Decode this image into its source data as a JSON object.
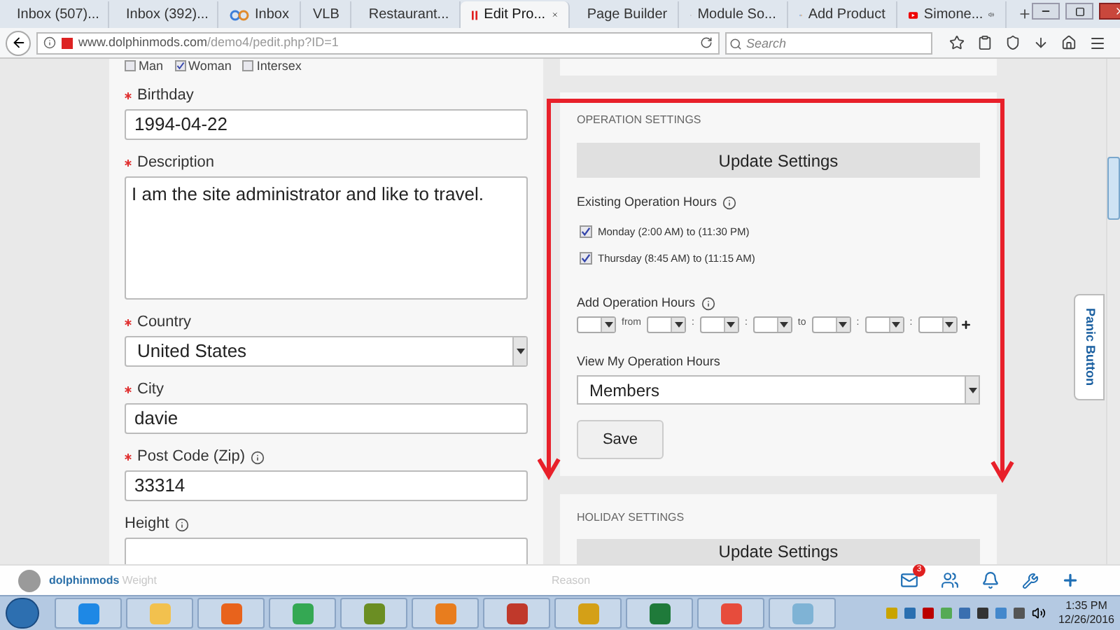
{
  "browser": {
    "tabs": [
      {
        "label": "Inbox (507)...",
        "kind": "mail",
        "selected": false
      },
      {
        "label": "Inbox (392)...",
        "kind": "mail",
        "selected": false
      },
      {
        "label": "Inbox",
        "kind": "loop",
        "selected": false
      },
      {
        "label": "VLB",
        "kind": "plain",
        "selected": false
      },
      {
        "label": "Restaurant...",
        "kind": "loop",
        "selected": false
      },
      {
        "label": "Edit Pro...",
        "kind": "bars",
        "selected": true
      },
      {
        "label": "Page Builder",
        "kind": "bars",
        "selected": false
      },
      {
        "label": "Module So...",
        "kind": "loop",
        "selected": false
      },
      {
        "label": "Add Product",
        "kind": "loop",
        "selected": false
      },
      {
        "label": "Simone...",
        "kind": "video",
        "selected": false,
        "audio": true
      }
    ],
    "url": {
      "domain": "www.dolphinmods.com",
      "path": "/demo4/pedit.php?ID=1"
    },
    "search": {
      "placeholder": "Search"
    }
  },
  "profile_form": {
    "gender_options": [
      {
        "label": "Man",
        "checked": false
      },
      {
        "label": "Woman",
        "checked": true
      },
      {
        "label": "Intersex",
        "checked": false
      }
    ],
    "fields": [
      {
        "kind": "input",
        "label": "Birthday",
        "required": true,
        "info": false,
        "value": "1994-04-22"
      },
      {
        "kind": "textarea",
        "label": "Description",
        "required": true,
        "info": false,
        "value": "I am the site administrator and like to travel."
      },
      {
        "kind": "select",
        "label": "Country",
        "required": true,
        "info": false,
        "value": "United States"
      },
      {
        "kind": "input",
        "label": "City",
        "required": true,
        "info": false,
        "value": "davie"
      },
      {
        "kind": "input",
        "label": "Post Code (Zip)",
        "required": true,
        "info": true,
        "value": "33314"
      },
      {
        "kind": "input",
        "label": "Height",
        "required": false,
        "info": true
      }
    ]
  },
  "operation_settings": {
    "heading": "OPERATION SETTINGS",
    "update_button": "Update Settings",
    "existing_label": "Existing Operation Hours",
    "hours": [
      {
        "label": "Monday (2:00 AM) to (11:30 PM)",
        "checked": true
      },
      {
        "label": "Thursday (8:45 AM) to (11:15 AM)",
        "checked": true
      }
    ],
    "add_label": "Add Operation Hours",
    "add_row": [
      {
        "kind": "select"
      },
      {
        "kind": "text",
        "text": "from"
      },
      {
        "kind": "select"
      },
      {
        "kind": "text",
        "text": ":"
      },
      {
        "kind": "select"
      },
      {
        "kind": "text",
        "text": ":"
      },
      {
        "kind": "select"
      },
      {
        "kind": "text",
        "text": "to"
      },
      {
        "kind": "select"
      },
      {
        "kind": "text",
        "text": ":"
      },
      {
        "kind": "select"
      },
      {
        "kind": "text",
        "text": ":"
      },
      {
        "kind": "select"
      }
    ],
    "view_label": "View My Operation Hours",
    "view_value": "Members",
    "save_button": "Save"
  },
  "holiday_settings": {
    "heading": "HOLIDAY SETTINGS",
    "update_button": "Update Settings"
  },
  "panic_button": "Panic Button",
  "bottom_bar": {
    "username": "dolphinmods",
    "faded_labels": [
      "Weight",
      "Reason"
    ],
    "mail_badge": "3"
  },
  "taskbar": {
    "time": "1:35 PM",
    "date": "12/26/2016"
  }
}
